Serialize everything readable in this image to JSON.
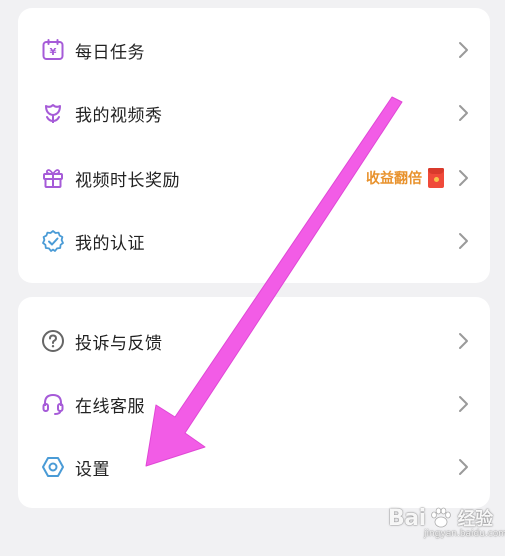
{
  "menu_group_1": [
    {
      "label": "每日任务",
      "icon": "calendar-yen-icon"
    },
    {
      "label": "我的视频秀",
      "icon": "flower-icon"
    },
    {
      "label": "视频时长奖励",
      "icon": "gift-icon",
      "extra": "收益翻倍",
      "extra_icon": "red-packet-icon"
    },
    {
      "label": "我的认证",
      "icon": "verified-badge-icon"
    }
  ],
  "menu_group_2": [
    {
      "label": "投诉与反馈",
      "icon": "question-circle-icon"
    },
    {
      "label": "在线客服",
      "icon": "headset-icon"
    },
    {
      "label": "设置",
      "icon": "settings-hexagon-icon"
    }
  ],
  "watermark": {
    "text_left": "Bai",
    "text_right": "经验",
    "sub": "jingyan.baidu.com"
  },
  "colors": {
    "background": "#f1f1f3",
    "card": "#ffffff",
    "icon_purple": "#a65bd8",
    "icon_blue": "#4a9bd6",
    "highlight_orange": "#e8922d",
    "annotation_arrow": "#f25ce6"
  }
}
